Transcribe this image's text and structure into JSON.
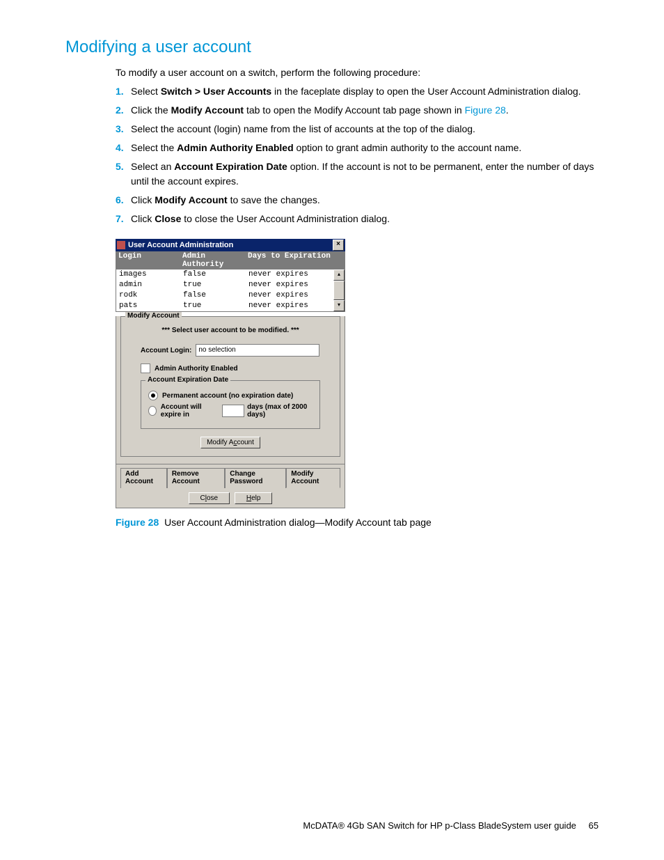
{
  "heading": "Modifying a user account",
  "intro": "To modify a user account on a switch, perform the following procedure:",
  "steps": {
    "s1a": "Select ",
    "s1b": "Switch > User Accounts",
    "s1c": " in the faceplate display to open the User Account Administration dialog.",
    "s2a": "Click the ",
    "s2b": "Modify Account",
    "s2c": " tab to open the Modify Account tab page shown in ",
    "s2link": "Figure 28",
    "s2d": ".",
    "s3": "Select the account (login) name from the list of accounts at the top of the dialog.",
    "s4a": "Select the ",
    "s4b": "Admin Authority Enabled",
    "s4c": " option to grant admin authority to the account name.",
    "s5a": "Select an ",
    "s5b": "Account Expiration Date",
    "s5c": " option. If the account is not to be permanent, enter the number of days until the account expires.",
    "s6a": "Click ",
    "s6b": "Modify Account",
    "s6c": " to save the changes.",
    "s7a": "Click ",
    "s7b": "Close",
    "s7c": " to close the User Account Administration dialog."
  },
  "dialog": {
    "title": "User Account Administration",
    "close_x": "×",
    "cols": {
      "login": "Login",
      "auth": "Admin Authority",
      "exp": "Days to Expiration"
    },
    "rows": [
      {
        "login": "images",
        "auth": "false",
        "exp": "never expires"
      },
      {
        "login": "admin",
        "auth": "true",
        "exp": "never expires"
      },
      {
        "login": "rodk",
        "auth": "false",
        "exp": "never expires"
      },
      {
        "login": "pats",
        "auth": "true",
        "exp": "never expires"
      }
    ],
    "scroll_up": "▴",
    "scroll_down": "▾",
    "group_modify": "Modify Account",
    "hint": "*** Select user account to be modified. ***",
    "account_login_label": "Account Login:",
    "account_login_value": "no selection",
    "admin_enabled_label": "Admin Authority Enabled",
    "group_expiration": "Account Expiration Date",
    "radio_permanent": "Permanent account (no expiration date)",
    "radio_expire_prefix": "Account will expire in",
    "radio_expire_suffix": "days (max of 2000 days)",
    "btn_modify": "Modify Account",
    "tabs": {
      "add": "Add Account",
      "remove": "Remove Account",
      "change": "Change Password",
      "modify": "Modify Account"
    },
    "btn_close_pre": "C",
    "btn_close_u": "l",
    "btn_close_post": "ose",
    "btn_help_u": "H",
    "btn_help_post": "elp"
  },
  "caption": {
    "label": "Figure 28",
    "text": "  User Account Administration dialog—Modify Account tab page"
  },
  "footer": {
    "text": "McDATA® 4Gb SAN Switch for HP p-Class BladeSystem user guide",
    "page": "65"
  }
}
